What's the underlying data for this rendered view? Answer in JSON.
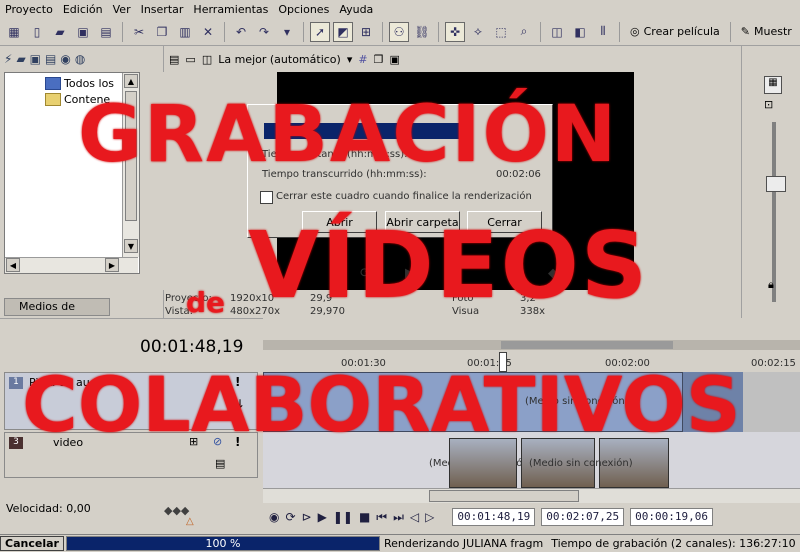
{
  "menu": [
    "Proyecto",
    "Edición",
    "Ver",
    "Insertar",
    "Herramientas",
    "Opciones",
    "Ayuda"
  ],
  "toolbar": {
    "render_label": "Crear película",
    "right_label": "Muestr"
  },
  "explorer": {
    "items": [
      "Todos los",
      "Contene"
    ],
    "tab_label": "Medios de proye"
  },
  "preview": {
    "quality_label": "La mejor (automático)",
    "project_label": "Proyecto:",
    "project_value": "1920x10",
    "project_value2": "29,9",
    "display_label": "Vista:",
    "display_value": "480x270x",
    "display_value2": "29,970",
    "frame_label": "Foto",
    "frame_value": "3,2",
    "frame_display_label": "Visua",
    "frame_display_value": "338x"
  },
  "dialog": {
    "line1_label": "Tiempo transcurrido (hh:mm:ss):",
    "line1_value": "00:02:06",
    "line0_label": "Tiempo restante (hh:mm:ss):",
    "line0_value": "00",
    "checkbox_label": "Cerrar este cuadro cuando finalice la renderización",
    "btn_abort": "Abrir",
    "btn_open_folder": "Abrir carpeta",
    "btn_close": "Cerrar",
    "progress_fraction": 0.75
  },
  "timeline": {
    "current_time": "00:01:48,19",
    "ruler_labels": [
      "00:01:30",
      "00:01:45",
      "00:02:00",
      "00:02:15"
    ],
    "tracks": [
      {
        "number": "1",
        "name": "Pista de audio"
      },
      {
        "number": "3",
        "name": "video"
      }
    ],
    "offline_label": "(Medio sin conexión)",
    "speed_label": "Velocidad: 0,00"
  },
  "transport": {
    "tc_current": "00:01:48,19",
    "tc_end": "00:02:07,25",
    "tc_length": "00:00:19,06"
  },
  "status": {
    "cancel_label": "Cancelar",
    "progress_label": "100 %",
    "progress_fraction": 1.0,
    "render_text": "Renderizando JULIANA fragm",
    "record_time": "Tiempo de grabación (2 canales): 136:27:10"
  },
  "overlay": {
    "line1": "GRABACIÓN",
    "line2": "VÍDEOS",
    "line_de": "de",
    "line3": "COLABORATIVOS",
    "color": "#e8191e"
  }
}
